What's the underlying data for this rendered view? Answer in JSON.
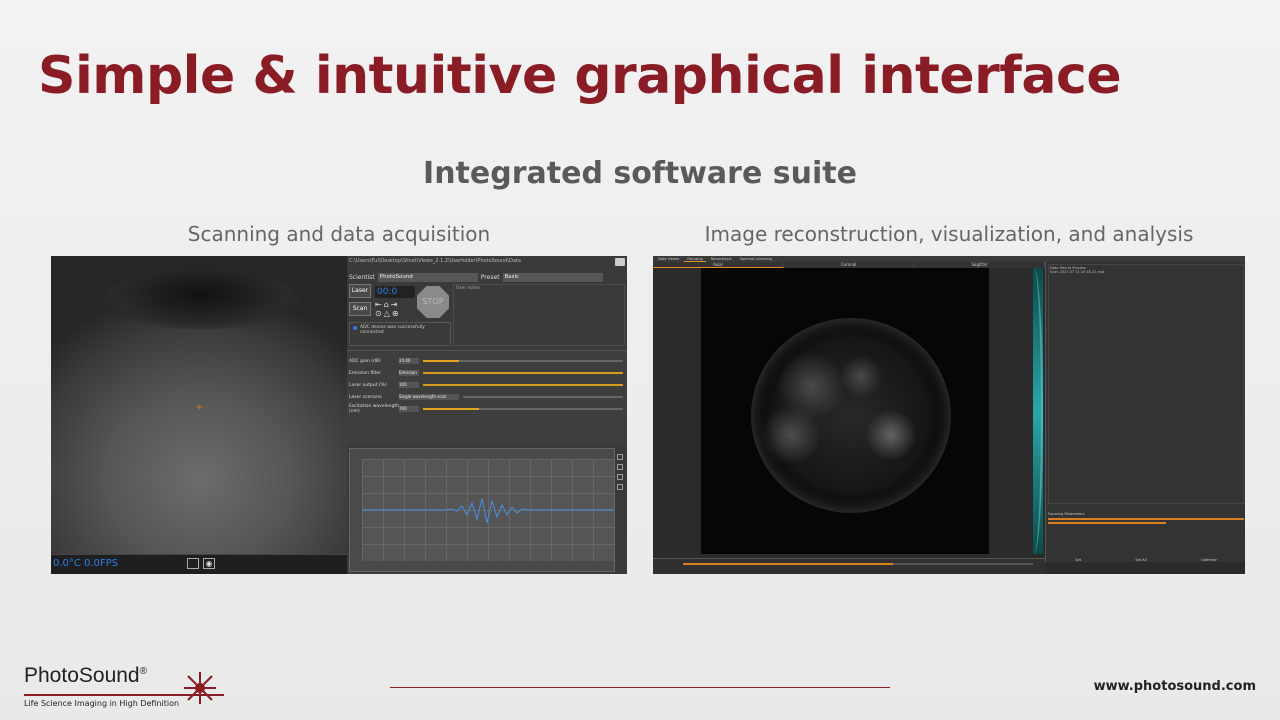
{
  "slide": {
    "title": "Simple & intuitive graphical interface",
    "subtitle": "Integrated software suite",
    "caption_left": "Scanning and data acquisition",
    "caption_right": "Image reconstruction, visualization, and analysis"
  },
  "acquisition_ui": {
    "path": "C:\\Users\\Ful\\Desktop\\Silvet\\Views_2.1.2\\Userfolder\\PhotoSound\\Data",
    "scientist_label": "Scientist",
    "scientist_value": "PhotoSound",
    "preset_label": "Preset",
    "preset_value": "Basic",
    "laser_button": "Laser",
    "scan_button": "Scan",
    "timer": "00:0",
    "stop_label": "STOP",
    "status_message": "ADC device was successfully connected",
    "user_notes": "User notes",
    "fps_readout": "0.0°C 0.0FPS",
    "params": [
      {
        "label": "ADC gain (dB)",
        "value": "24.00"
      },
      {
        "label": "Emission filter",
        "value": "Emission"
      },
      {
        "label": "Laser output (%)",
        "value": "100"
      },
      {
        "label": "Laser scenario",
        "value": "Single wavelength scan"
      },
      {
        "label": "Excitation wavelength (nm)",
        "value": "700"
      }
    ]
  },
  "reconstruction_ui": {
    "tabs": [
      "Data Viewer",
      "Focusing",
      "Reconstruct",
      "Spectral Unmixing"
    ],
    "views": [
      "Axial",
      "Coronal",
      "Sagittal"
    ],
    "list_header": "Data files to Process",
    "list_item": "Scan 2021 07 21 16 48 22.mat",
    "params_header": "Focusing Parameters",
    "buttons": [
      "Set",
      "Set All",
      "Optimize"
    ]
  },
  "footer": {
    "brand": "PhotoSound",
    "brand_mark": "®",
    "tagline": "Life Science Imaging in High Definition",
    "url": "www.photosound.com"
  },
  "colors": {
    "brand": "#8a1c26",
    "accent": "#e0902a",
    "blue": "#2b7de0"
  }
}
